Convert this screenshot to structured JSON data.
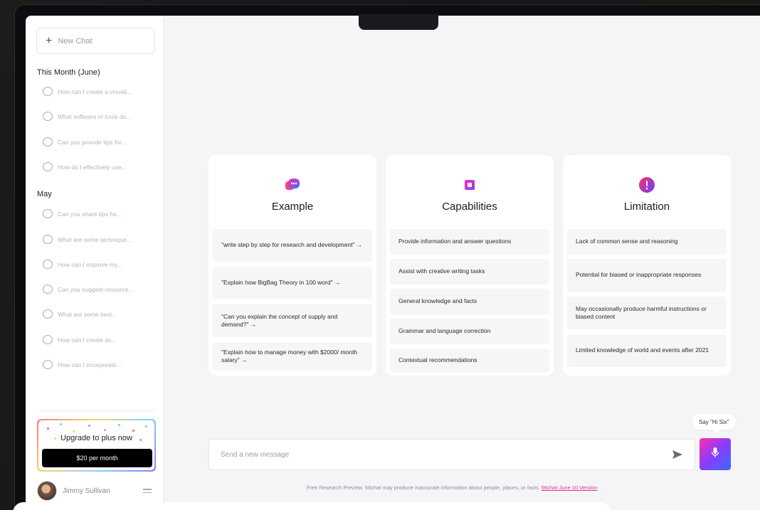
{
  "sidebar": {
    "new_chat": "New Chat",
    "sections": [
      {
        "title": "This Month (June)",
        "items": [
          "How can I create a visuali...",
          "What software or tools do...",
          "Can you provide tips for...",
          "How do I effectively use..."
        ]
      },
      {
        "title": "May",
        "items": [
          "Can you share tips for...",
          "What are some technique...",
          "How can I improve my...",
          "Can you suggest resource...",
          "What are some best...",
          "How can I create an...",
          "How can I incorporate..."
        ]
      }
    ],
    "upgrade": {
      "title": "Upgrade to plus now",
      "button": "$20 per month"
    },
    "user": {
      "name": "Jimmy Sullivan"
    }
  },
  "cards": [
    {
      "title": "Example",
      "icon": "chat-bubble-icon",
      "items": [
        "\"write step by step for research and development\" →",
        "\"Explain how BigBag Theory in 100 word\" →",
        "\"Can you explain the concept of supply and demand?\" →",
        "\"Explain how to manage money with $2000/ month salary\" →"
      ]
    },
    {
      "title": "Capabilities",
      "icon": "chip-icon",
      "items": [
        "Provide information and answer questions",
        "Assist with creative writing tasks",
        "General knowledge and facts",
        "Grammar and language correction",
        "Contextual recommendations"
      ]
    },
    {
      "title": "Limitation",
      "icon": "alert-icon",
      "items": [
        "Lack of common sense and reasoning",
        "Potential for biased or inappropriate responses",
        "May occasionally produce harmful instructions or biased content",
        "Limited knowledge of world and events after 2021"
      ]
    }
  ],
  "input": {
    "placeholder": "Send a new message"
  },
  "voice": {
    "tooltip": "Say \"Hi Six\""
  },
  "footer": {
    "text": "Free Research Preview. 66chat may produce inaccurate information about people, places, or facts.",
    "link": "66chat June 10 Version"
  },
  "colors": {
    "accent_pink": "#ff2fa8",
    "accent_purple": "#8a3cff",
    "accent_blue": "#3a6bff",
    "link": "#e0338a"
  }
}
